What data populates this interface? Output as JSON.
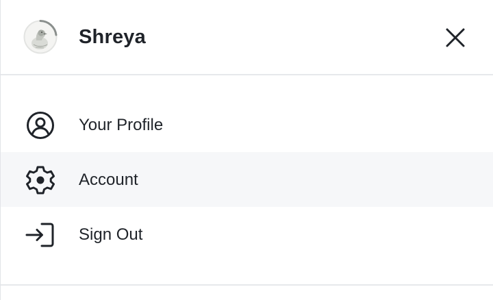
{
  "header": {
    "avatar_icon": "user-avatar-photo",
    "user_name": "Shreya",
    "close_icon": "close-icon"
  },
  "menu": {
    "items": [
      {
        "label": "Your Profile",
        "icon": "user-circle-icon",
        "active": false
      },
      {
        "label": "Account",
        "icon": "gear-icon",
        "active": true
      },
      {
        "label": "Sign Out",
        "icon": "sign-out-icon",
        "active": false
      }
    ]
  },
  "colors": {
    "text": "#1f2329",
    "divider": "#e6e8eb",
    "active_row": "#f6f7f9",
    "avatar_ring": "#8a8f8d"
  }
}
